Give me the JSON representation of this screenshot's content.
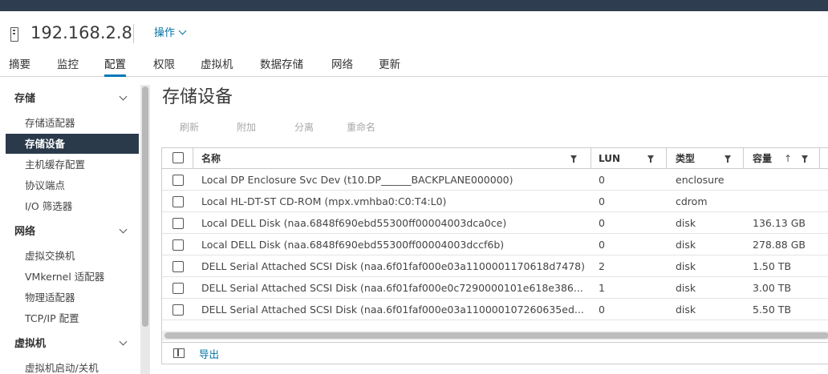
{
  "header": {
    "host_icon": "server-icon",
    "host_title": "192.168.2.8",
    "actions_label": "操作"
  },
  "tabs": [
    {
      "label": "摘要"
    },
    {
      "label": "监控"
    },
    {
      "label": "配置",
      "active": true
    },
    {
      "label": "权限"
    },
    {
      "label": "虚拟机"
    },
    {
      "label": "数据存储"
    },
    {
      "label": "网络"
    },
    {
      "label": "更新"
    }
  ],
  "sidebar": {
    "sections": [
      {
        "label": "存储",
        "items": [
          "存储适配器",
          "存储设备",
          "主机缓存配置",
          "协议端点",
          "I/O 筛选器"
        ]
      },
      {
        "label": "网络",
        "items": [
          "虚拟交换机",
          "VMkernel 适配器",
          "物理适配器",
          "TCP/IP 配置"
        ]
      },
      {
        "label": "虚拟机",
        "items": [
          "虚拟机启动/关机"
        ]
      }
    ],
    "active_item": "存储设备"
  },
  "main": {
    "title": "存储设备",
    "toolbar": {
      "refresh": "刷新",
      "attach": "附加",
      "detach": "分离",
      "rename": "重命名"
    },
    "columns": {
      "name": "名称",
      "lun": "LUN",
      "type": "类型",
      "capacity": "容量"
    },
    "rows": [
      {
        "name": "Local DP Enclosure Svc Dev (t10.DP______BACKPLANE000000)",
        "lun": "0",
        "type": "enclosure",
        "capacity": ""
      },
      {
        "name": "Local HL-DT-ST CD-ROM (mpx.vmhba0:C0:T4:L0)",
        "lun": "0",
        "type": "cdrom",
        "capacity": ""
      },
      {
        "name": "Local DELL Disk (naa.6848f690ebd55300ff00004003dca0ce)",
        "lun": "0",
        "type": "disk",
        "capacity": "136.13 GB"
      },
      {
        "name": "Local DELL Disk (naa.6848f690ebd55300ff00004003dccf6b)",
        "lun": "0",
        "type": "disk",
        "capacity": "278.88 GB"
      },
      {
        "name": "DELL Serial Attached SCSI Disk (naa.6f01faf000e03a1100001170618d7478)",
        "lun": "2",
        "type": "disk",
        "capacity": "1.50 TB"
      },
      {
        "name": "DELL Serial Attached SCSI Disk (naa.6f01faf000e0c7290000101e618e386...",
        "lun": "1",
        "type": "disk",
        "capacity": "3.00 TB"
      },
      {
        "name": "DELL Serial Attached SCSI Disk (naa.6f01faf000e03a110000107260635ed...",
        "lun": "0",
        "type": "disk",
        "capacity": "5.50 TB"
      }
    ],
    "footer": {
      "export_label": "导出"
    }
  }
}
